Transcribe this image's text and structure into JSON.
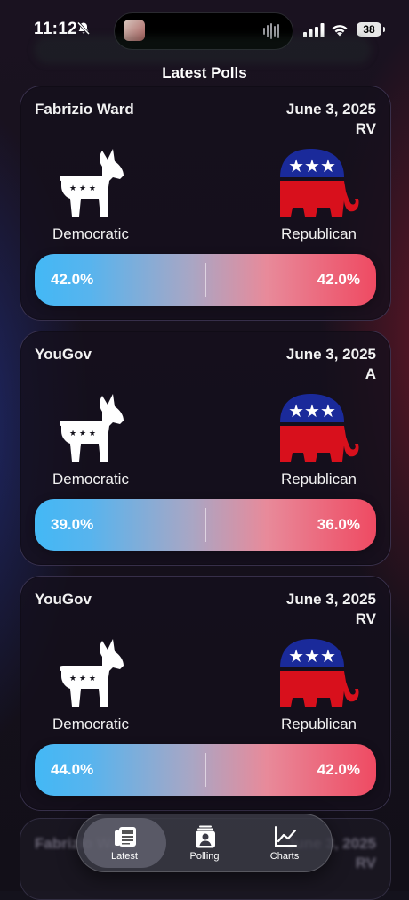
{
  "status_bar": {
    "time": "11:12",
    "battery": "38"
  },
  "page": {
    "title": "Latest Polls"
  },
  "colors": {
    "democratic": "#43b8f5",
    "republican": "#ef4a62",
    "elephant_blue": "#1a2a9a",
    "elephant_red": "#d8101c"
  },
  "polls": [
    {
      "pollster": "Fabrizio Ward",
      "date": "June 3, 2025",
      "population": "RV",
      "dem_label": "Democratic",
      "rep_label": "Republican",
      "dem_pct": "42.0%",
      "rep_pct": "42.0%"
    },
    {
      "pollster": "YouGov",
      "date": "June 3, 2025",
      "population": "A",
      "dem_label": "Democratic",
      "rep_label": "Republican",
      "dem_pct": "39.0%",
      "rep_pct": "36.0%"
    },
    {
      "pollster": "YouGov",
      "date": "June 3, 2025",
      "population": "RV",
      "dem_label": "Democratic",
      "rep_label": "Republican",
      "dem_pct": "44.0%",
      "rep_pct": "42.0%"
    },
    {
      "pollster": "Fabrizio Ward",
      "date": "June 3, 2025",
      "population": "RV"
    }
  ],
  "tabs": [
    {
      "label": "Latest",
      "icon": "newspaper-icon",
      "active": true
    },
    {
      "label": "Polling",
      "icon": "person-card-icon",
      "active": false
    },
    {
      "label": "Charts",
      "icon": "line-chart-icon",
      "active": false
    }
  ]
}
